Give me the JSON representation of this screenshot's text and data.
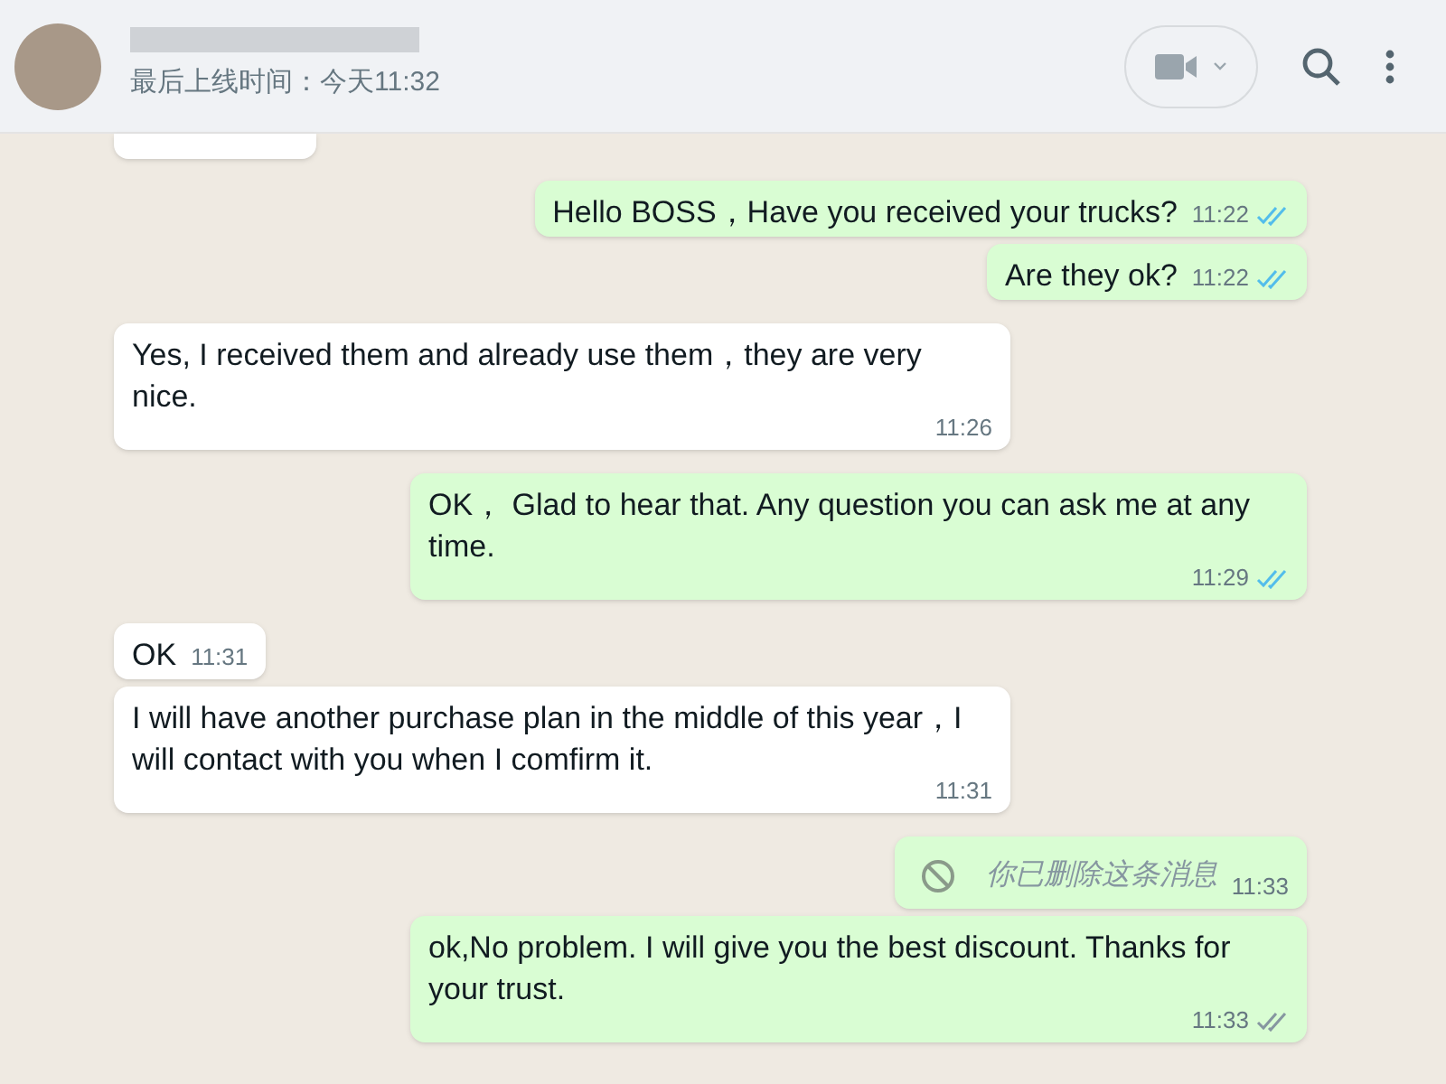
{
  "header": {
    "status": "最后上线时间：今天11:32"
  },
  "messages": [
    {
      "kind": "text",
      "outgoing": true,
      "text": "Hello BOSS，Have you received your trucks?",
      "time": "11:22",
      "read": true
    },
    {
      "kind": "text",
      "outgoing": true,
      "text": "Are they ok?",
      "time": "11:22",
      "read": true
    },
    {
      "kind": "text",
      "outgoing": false,
      "text": "Yes, I received them and already use them，they are very nice.",
      "time": "11:26"
    },
    {
      "kind": "text",
      "outgoing": true,
      "text": "OK， Glad to hear that. Any question you can ask me at any time.",
      "time": "11:29",
      "read": true
    },
    {
      "kind": "text",
      "outgoing": false,
      "text": "OK",
      "time": "11:31"
    },
    {
      "kind": "text",
      "outgoing": false,
      "text": "I will have another purchase plan in the middle of this year，I will contact with you when I comfirm it.",
      "time": "11:31"
    },
    {
      "kind": "deleted",
      "outgoing": true,
      "text": "你已删除这条消息",
      "time": "11:33"
    },
    {
      "kind": "text",
      "outgoing": true,
      "text": "ok,No problem. I will give you the best discount. Thanks for your trust.",
      "time": "11:33",
      "read": false
    }
  ]
}
